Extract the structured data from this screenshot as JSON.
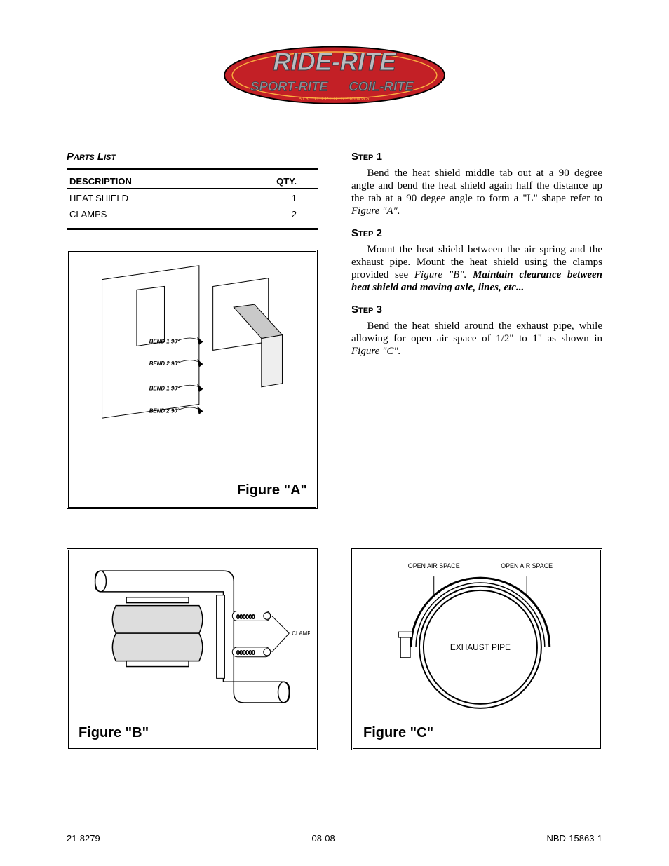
{
  "logo": {
    "line1": "RIDE-RITE",
    "line2_left": "SPORT-RITE",
    "line2_right": "COIL-RITE",
    "tagline": "AIR HELPER SPRINGS"
  },
  "parts_list": {
    "title": "Parts List",
    "headers": {
      "description": "DESCRIPTION",
      "qty": "QTY."
    },
    "rows": [
      {
        "description": "HEAT SHIELD",
        "qty": "1"
      },
      {
        "description": "CLAMPS",
        "qty": "2"
      }
    ]
  },
  "steps": [
    {
      "title": "Step 1",
      "body_plain": "Bend the heat shield middle tab out at a 90 degree angle and bend the heat shield again half the distance up the tab at a 90 degee angle to form a \"L\" shape refer to ",
      "body_italic": "Figure \"A\"."
    },
    {
      "title": "Step 2",
      "body_plain": "Mount the heat shield between the air spring and the exhaust pipe.  Mount the heat shield using the clamps provided see ",
      "body_italic": "Figure \"B\". ",
      "body_bolditalic": "Maintain clearance between heat shield and moving axle, lines, etc..."
    },
    {
      "title": "Step 3",
      "body_plain": "Bend the heat shield around the exhaust pipe, while allowing for open air space of 1/2\" to 1\" as shown in ",
      "body_italic": "Figure \"C\"."
    }
  ],
  "figures": {
    "a": {
      "caption": "Figure \"A\"",
      "bend_labels": [
        "BEND 1 90°",
        "BEND 2 90°",
        "BEND 1 90°",
        "BEND 2 90°"
      ]
    },
    "b": {
      "caption": "Figure \"B\"",
      "clamps_label": "CLAMPS"
    },
    "c": {
      "caption": "Figure \"C\"",
      "air_space_label": "OPEN AIR SPACE",
      "exhaust_label": "EXHAUST PIPE"
    }
  },
  "footer": {
    "left": "21-8279",
    "center": "08-08",
    "right": "NBD-15863-1"
  }
}
